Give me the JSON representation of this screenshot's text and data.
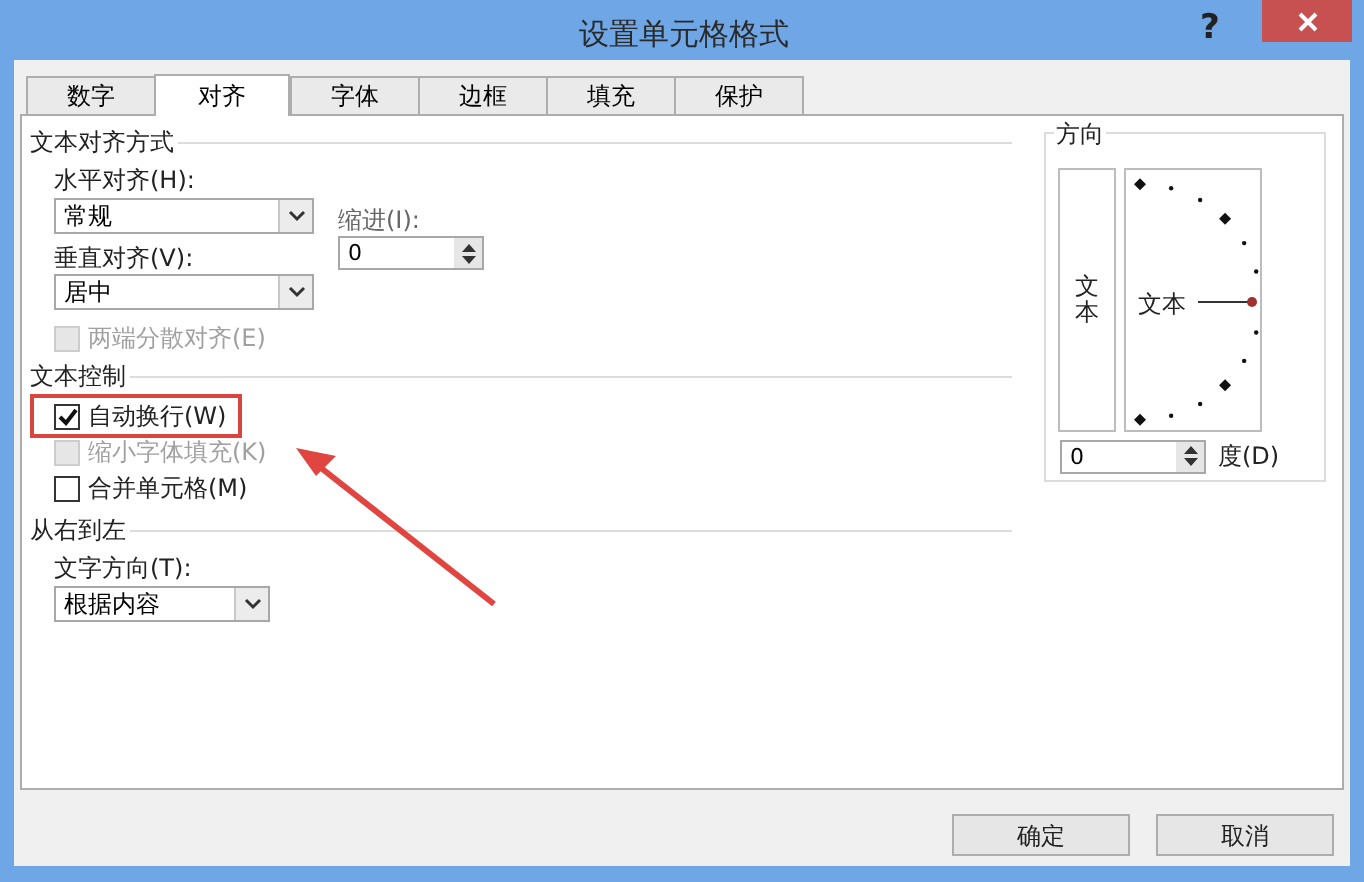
{
  "window": {
    "title": "设置单元格格式",
    "help": "?"
  },
  "tabs": [
    {
      "label": "数字",
      "selected": false
    },
    {
      "label": "对齐",
      "selected": true
    },
    {
      "label": "字体",
      "selected": false
    },
    {
      "label": "边框",
      "selected": false
    },
    {
      "label": "填充",
      "selected": false
    },
    {
      "label": "保护",
      "selected": false
    }
  ],
  "text_alignment": {
    "title": "文本对齐方式",
    "horizontal": {
      "label": "水平对齐(H):",
      "value": "常规"
    },
    "indent": {
      "label": "缩进(I):",
      "value": "0"
    },
    "vertical": {
      "label": "垂直对齐(V):",
      "value": "居中"
    },
    "distributed": {
      "label": "两端分散对齐(E)",
      "checked": false,
      "disabled": true
    }
  },
  "text_control": {
    "title": "文本控制",
    "options": [
      {
        "label": "自动换行(W)",
        "checked": true,
        "disabled": false
      },
      {
        "label": "缩小字体填充(K)",
        "checked": false,
        "disabled": true
      },
      {
        "label": "合并单元格(M)",
        "checked": false,
        "disabled": false
      }
    ]
  },
  "right_to_left": {
    "title": "从右到左",
    "direction": {
      "label": "文字方向(T):",
      "value": "根据内容"
    }
  },
  "orientation": {
    "title": "方向",
    "vertical_text": "文本",
    "dial_text": "文本",
    "degrees": {
      "value": "0",
      "label": "度(D)"
    }
  },
  "buttons": [
    "确定",
    "取消"
  ]
}
